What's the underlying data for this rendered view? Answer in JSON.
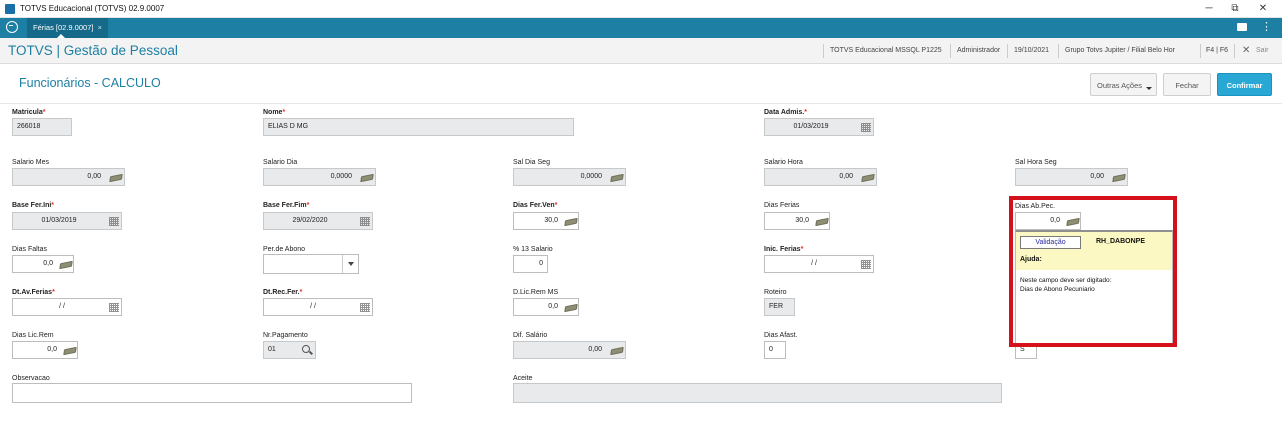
{
  "window": {
    "title": "TOTVS Educacional (TOTVS) 02.9.0007",
    "minimize": "─",
    "restore": "⧉",
    "close": "✕"
  },
  "tab": {
    "label": "Férias [02.9.0007]",
    "close": "×"
  },
  "header": {
    "app_title": "TOTVS | Gestão de Pessoal",
    "environment": "TOTVS Educacional MSSQL P1225",
    "user": "Administrador",
    "date": "19/10/2021",
    "group": "Grupo Totvs Jupiter / Filial Belo Hor",
    "shortcut": "F4 | F6",
    "exit_icon": "✕",
    "exit_label": "Sair"
  },
  "page": {
    "title": "Funcionários - CALCULO",
    "more_actions": "Outras Ações",
    "close": "Fechar",
    "confirm": "Confirmar"
  },
  "required_mark": "*",
  "fields": {
    "matricula": {
      "label": "Matricula",
      "value": "266018"
    },
    "nome": {
      "label": "Nome",
      "value": "ELIAS D MG"
    },
    "data_admis": {
      "label": "Data Admis.",
      "value": "01/03/2019"
    },
    "salario_mes": {
      "label": "Salario Mes",
      "value": "0,00"
    },
    "salario_dia": {
      "label": "Salario Dia",
      "value": "0,0000"
    },
    "sal_dia_seg": {
      "label": "Sal Dia Seg",
      "value": "0,0000"
    },
    "salario_hora": {
      "label": "Salario Hora",
      "value": "0,00"
    },
    "sal_hora_seg": {
      "label": "Sal Hora Seg",
      "value": "0,00"
    },
    "base_fer_ini": {
      "label": "Base Fer.Ini",
      "value": "01/03/2019"
    },
    "base_fer_fim": {
      "label": "Base Fer.Fim",
      "value": "29/02/2020"
    },
    "dias_fer_ven": {
      "label": "Dias Fer.Ven",
      "value": "30,0"
    },
    "dias_ferias": {
      "label": "Dias Ferias",
      "value": "30,0"
    },
    "dias_ab_pec": {
      "label": "Dias Ab.Pec.",
      "value": "0,0"
    },
    "dias_faltas": {
      "label": "Dias Faltas",
      "value": "0,0"
    },
    "per_abono": {
      "label": "Per.de Abono",
      "value": ""
    },
    "pct_13_salario": {
      "label": "% 13 Salario",
      "value": "0"
    },
    "inic_ferias": {
      "label": "Inic. Ferias",
      "value": "/ /"
    },
    "dt_av_ferias": {
      "label": "Dt.Av.Ferias",
      "value": "/ /"
    },
    "dt_rec_fer": {
      "label": "Dt.Rec.Fer.",
      "value": "/ /"
    },
    "d_lic_rem_ms": {
      "label": "D.Lic.Rem MS",
      "value": "0,0"
    },
    "roteiro": {
      "label": "Roteiro",
      "value": "FER"
    },
    "dias_lic_rem": {
      "label": "Dias Lic.Rem",
      "value": "0,0"
    },
    "nr_pagamento": {
      "label": "Nr.Pagamento",
      "value": "01"
    },
    "dif_salario": {
      "label": "Dif. Salário",
      "value": "0,00"
    },
    "dias_afast": {
      "label": "Dias Afast.",
      "value": "0"
    },
    "hidden_s": {
      "value": "S"
    },
    "observacao": {
      "label": "Observacao",
      "value": ""
    },
    "aceite": {
      "label": "Aceite",
      "value": ""
    }
  },
  "help_popup": {
    "validation_button": "Validação",
    "field_code": "RH_DABONPE",
    "help_title": "Ajuda:",
    "text_line1": "Neste campo deve ser digitado:",
    "text_line2": "Dias de Abono Pecuniario"
  },
  "colors": {
    "accent": "#1c7fa3",
    "confirm": "#29a8d6",
    "highlight_border": "#d4101a",
    "help_bg": "#fbf8c4",
    "required": "#d32222"
  }
}
